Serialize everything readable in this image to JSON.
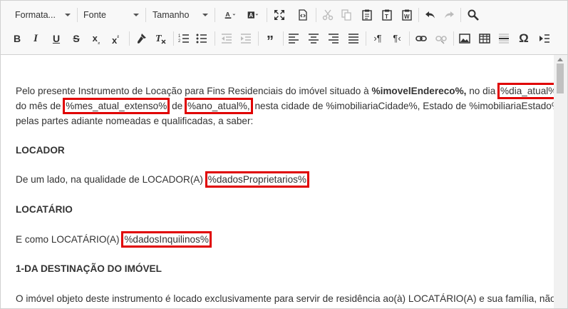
{
  "toolbar": {
    "format_label": "Formata...",
    "font_label": "Fonte",
    "size_label": "Tamanho"
  },
  "icons": {
    "row1": [
      "font-color-icon",
      "background-color-icon",
      "maximize-icon",
      "source-icon",
      "cut-icon",
      "copy-icon",
      "paste-icon",
      "paste-text-icon",
      "paste-word-icon",
      "undo-icon",
      "redo-icon",
      "find-icon"
    ],
    "row2": [
      "bold-icon",
      "italic-icon",
      "underline-icon",
      "strikethrough-icon",
      "subscript-icon",
      "superscript-icon",
      "copy-format-icon",
      "remove-format-icon",
      "numbered-list-icon",
      "bulleted-list-icon",
      "outdent-icon",
      "indent-icon",
      "blockquote-icon",
      "align-left-icon",
      "align-center-icon",
      "align-right-icon",
      "justify-icon",
      "ltr-icon",
      "rtl-icon",
      "link-icon",
      "unlink-icon",
      "image-icon",
      "table-icon",
      "horizontal-line-icon",
      "special-char-icon",
      "page-break-icon"
    ]
  },
  "document": {
    "p1_a": "Pelo presente Instrumento de Locação para Fins Residenciais do imóvel situado à ",
    "p1_b": "%imovelEndereco%,",
    "p1_c": " no dia ",
    "p1_d": "%dia_atual%",
    "p2_a": "do mês de ",
    "p2_b": "%mes_atual_extenso%",
    "p2_c": " de ",
    "p2_d": "%ano_atual%,",
    "p2_e": " nesta cidade de %imobiliariaCidade%, Estado de %imobiliariaEstado%,",
    "p3": "pelas partes adiante nomeadas e qualificadas, a saber:",
    "h_locador": "LOCADOR",
    "p4_a": "De um lado, na qualidade de LOCADOR(A) ",
    "p4_b": "%dadosProprietarios%",
    "h_locatario": "LOCATÁRIO",
    "p5_a": "E como LOCATÁRIO(A) ",
    "p5_b": "%dadosInquilinos%",
    "h_destinacao": "1-DA DESTINAÇÃO DO IMÓVEL",
    "p6": "O imóvel objeto deste instrumento é locado exclusivamente para servir de residência ao(à) LOCATÁRIO(A) e sua família, não"
  },
  "colors": {
    "highlight_border": "#e00000",
    "toolbar_bg": "#f8f8f8"
  }
}
